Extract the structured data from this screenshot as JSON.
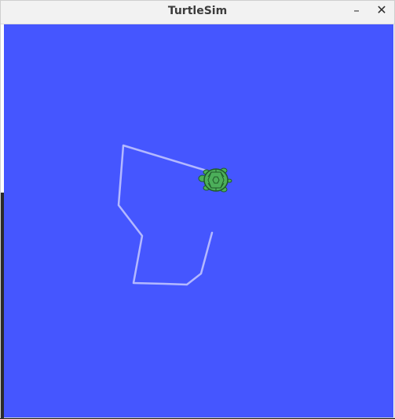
{
  "window": {
    "title": "TurtleSim",
    "minimize_glyph": "–",
    "close_glyph": "✕"
  },
  "canvas": {
    "background": "#4556ff",
    "pen_color": "#b3b8ff"
  },
  "turtle": {
    "icon": "turtle-icon",
    "shell_color": "#4caf5a",
    "outline_color": "#1f5a2a"
  }
}
